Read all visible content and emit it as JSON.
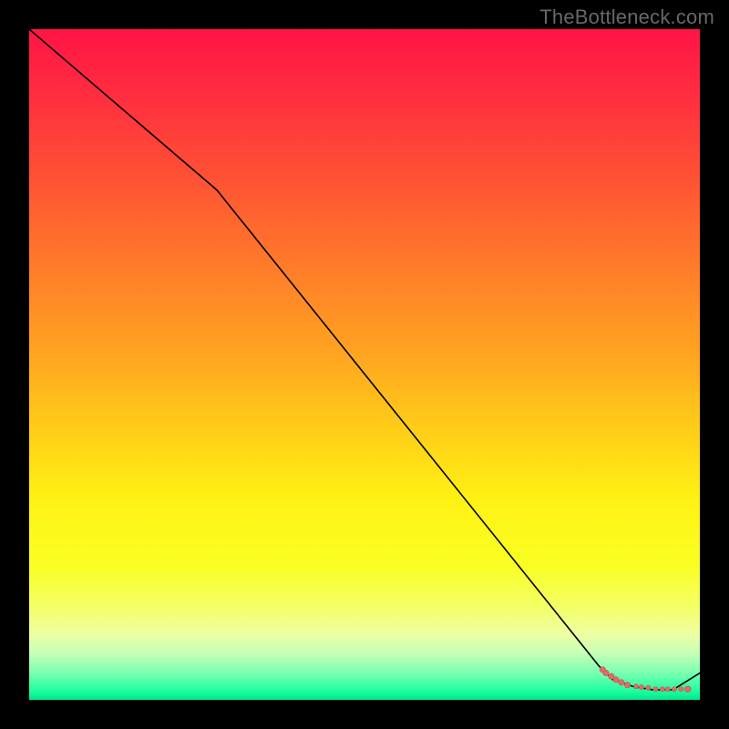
{
  "watermark": "TheBottleneck.com",
  "colors": {
    "frame": "#000000",
    "line": "#000000",
    "marker_fill": "#e36b64",
    "marker_stroke": "#bb5a56",
    "gradient_stops": [
      {
        "offset": 0.0,
        "color": "#ff1446"
      },
      {
        "offset": 0.1,
        "color": "#ff2e3f"
      },
      {
        "offset": 0.22,
        "color": "#ff5134"
      },
      {
        "offset": 0.35,
        "color": "#ff7a2a"
      },
      {
        "offset": 0.48,
        "color": "#ffa321"
      },
      {
        "offset": 0.6,
        "color": "#ffce18"
      },
      {
        "offset": 0.7,
        "color": "#fff114"
      },
      {
        "offset": 0.8,
        "color": "#faff23"
      },
      {
        "offset": 0.86,
        "color": "#f4ff64"
      },
      {
        "offset": 0.9,
        "color": "#efffa0"
      },
      {
        "offset": 0.93,
        "color": "#c7ffb6"
      },
      {
        "offset": 0.96,
        "color": "#7affb1"
      },
      {
        "offset": 0.985,
        "color": "#23ffa1"
      },
      {
        "offset": 1.0,
        "color": "#00e88f"
      }
    ]
  },
  "chart_data": {
    "type": "line",
    "title": "",
    "xlabel": "",
    "ylabel": "",
    "xlim": [
      0,
      100
    ],
    "ylim": [
      0,
      100
    ],
    "series": [
      {
        "name": "curve",
        "x": [
          0,
          28,
          85,
          87,
          90,
          93,
          96,
          100
        ],
        "y": [
          100,
          76,
          5,
          3,
          2,
          1.5,
          1.5,
          4
        ],
        "stroke_width": 1.6,
        "color_key": "line"
      }
    ],
    "markers": [
      {
        "x": 85.5,
        "y": 4.5,
        "r": 3.2
      },
      {
        "x": 86.0,
        "y": 4.0,
        "r": 3.2
      },
      {
        "x": 86.8,
        "y": 3.5,
        "r": 3.2
      },
      {
        "x": 87.5,
        "y": 3.0,
        "r": 3.2
      },
      {
        "x": 88.3,
        "y": 2.6,
        "r": 3.2
      },
      {
        "x": 89.2,
        "y": 2.2,
        "r": 3.2
      },
      {
        "x": 90.5,
        "y": 2.0,
        "r": 2.6
      },
      {
        "x": 91.3,
        "y": 1.9,
        "r": 2.6
      },
      {
        "x": 92.3,
        "y": 1.8,
        "r": 2.6
      },
      {
        "x": 93.4,
        "y": 1.6,
        "r": 2.6
      },
      {
        "x": 94.4,
        "y": 1.6,
        "r": 2.6
      },
      {
        "x": 95.2,
        "y": 1.6,
        "r": 2.6
      },
      {
        "x": 96.2,
        "y": 1.6,
        "r": 2.6
      },
      {
        "x": 97.2,
        "y": 1.6,
        "r": 2.6
      },
      {
        "x": 98.2,
        "y": 1.6,
        "r": 3.4
      }
    ]
  }
}
